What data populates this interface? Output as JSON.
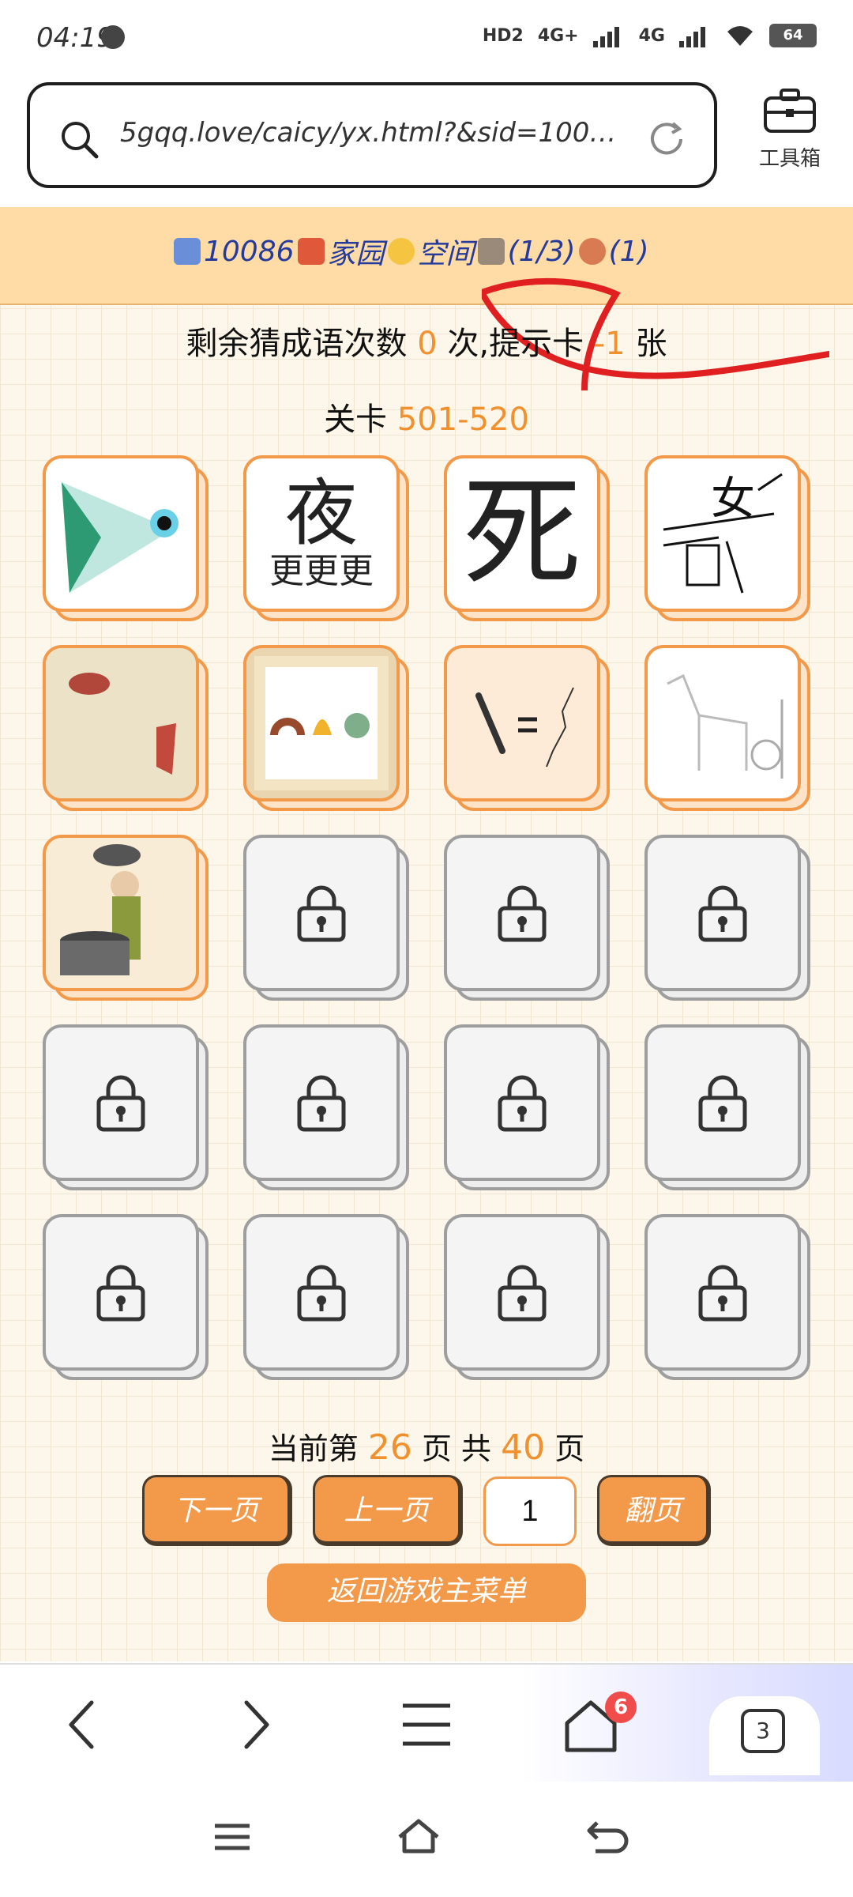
{
  "status_bar": {
    "time": "04:19",
    "network_a": "4G+",
    "network_b": "4G",
    "hd_label": "HD2",
    "battery": "64"
  },
  "browser": {
    "url": "5gqq.love/caicy/yx.html?&sid=10086.…",
    "toolbox_label": "工具箱",
    "tab_count": "3",
    "home_badge": "6"
  },
  "topnav": {
    "user_id": "10086",
    "home_link": "家园",
    "space_link": "空间",
    "count_a": "(1/3)",
    "count_b": "(1)"
  },
  "game": {
    "remain_prefix": "剩余猜成语次数",
    "remain_value": "0",
    "remain_mid": "次,提示卡",
    "hint_value": "-1",
    "hint_suffix": "张",
    "level_prefix": "关卡",
    "level_range": "501-520",
    "cards": [
      {
        "state": "open",
        "name": "card-eye-fan"
      },
      {
        "state": "open",
        "name": "card-night-geng",
        "glyph_top": "夜",
        "glyph_bottom": "更更更"
      },
      {
        "state": "open",
        "name": "card-death-eye",
        "glyph": "死"
      },
      {
        "state": "open",
        "name": "card-scattered-chars",
        "glyph": "女"
      },
      {
        "state": "open",
        "name": "card-scroll-fish"
      },
      {
        "state": "open",
        "name": "card-scroll-items"
      },
      {
        "state": "open",
        "name": "card-bone-equals"
      },
      {
        "state": "open",
        "name": "card-horse-soldier"
      },
      {
        "state": "open",
        "name": "card-well-stone"
      },
      {
        "state": "locked"
      },
      {
        "state": "locked"
      },
      {
        "state": "locked"
      },
      {
        "state": "locked"
      },
      {
        "state": "locked"
      },
      {
        "state": "locked"
      },
      {
        "state": "locked"
      },
      {
        "state": "locked"
      },
      {
        "state": "locked"
      },
      {
        "state": "locked"
      },
      {
        "state": "locked"
      }
    ]
  },
  "pagination": {
    "label_prefix": "当前第",
    "current_page": "26",
    "label_mid": "页 共",
    "total_pages": "40",
    "label_suffix": "页",
    "next_label": "下一页",
    "prev_label": "上一页",
    "jump_value": "1",
    "jump_label": "翻页",
    "menu_label": "返回游戏主菜单"
  }
}
